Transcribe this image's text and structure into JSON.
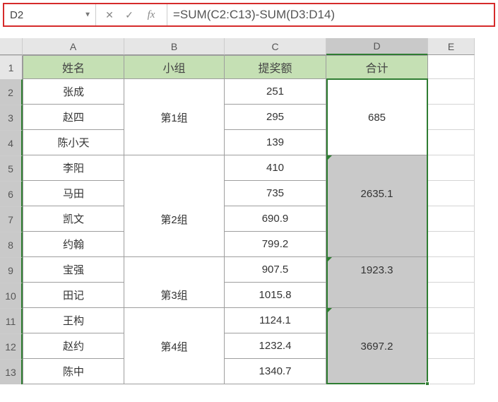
{
  "formula_bar": {
    "cell_ref": "D2",
    "cancel": "✕",
    "confirm": "✓",
    "fx": "fx",
    "formula": "=SUM(C2:C13)-SUM(D3:D14)"
  },
  "columns": {
    "A": "A",
    "B": "B",
    "C": "C",
    "D": "D",
    "E": "E"
  },
  "row_labels": [
    "1",
    "2",
    "3",
    "4",
    "5",
    "6",
    "7",
    "8",
    "9",
    "10",
    "11",
    "12",
    "13"
  ],
  "headers": {
    "name": "姓名",
    "group": "小组",
    "bonus": "提奖额",
    "total": "合计"
  },
  "names": [
    "张成",
    "赵四",
    "陈小天",
    "李阳",
    "马田",
    "凯文",
    "约翰",
    "宝强",
    "田记",
    "王构",
    "赵约",
    "陈中"
  ],
  "groups": {
    "g1": "第1组",
    "g2": "第2组",
    "g3": "第3组",
    "g4": "第4组"
  },
  "bonus": [
    "251",
    "295",
    "139",
    "410",
    "735",
    "690.9",
    "799.2",
    "907.5",
    "1015.8",
    "1124.1",
    "1232.4",
    "1340.7"
  ],
  "totals": {
    "d3": "685",
    "d6": "2635.1",
    "d9": "1923.3",
    "d12": "3697.2"
  },
  "chart_data": {
    "type": "table",
    "headers": [
      "姓名",
      "小组",
      "提奖额",
      "合计"
    ],
    "rows": [
      {
        "name": "张成",
        "group": "第1组",
        "bonus": 251,
        "total": null
      },
      {
        "name": "赵四",
        "group": "第1组",
        "bonus": 295,
        "total": 685
      },
      {
        "name": "陈小天",
        "group": "第1组",
        "bonus": 139,
        "total": null
      },
      {
        "name": "李阳",
        "group": "第2组",
        "bonus": 410,
        "total": null
      },
      {
        "name": "马田",
        "group": "第2组",
        "bonus": 735,
        "total": 2635.1
      },
      {
        "name": "凯文",
        "group": "第2组",
        "bonus": 690.9,
        "total": null
      },
      {
        "name": "约翰",
        "group": "第2组",
        "bonus": 799.2,
        "total": null
      },
      {
        "name": "宝强",
        "group": "第3组",
        "bonus": 907.5,
        "total": 1923.3
      },
      {
        "name": "田记",
        "group": "第3组",
        "bonus": 1015.8,
        "total": null
      },
      {
        "name": "王构",
        "group": "第4组",
        "bonus": 1124.1,
        "total": null
      },
      {
        "name": "赵约",
        "group": "第4组",
        "bonus": 1232.4,
        "total": 3697.2
      },
      {
        "name": "陈中",
        "group": "第4组",
        "bonus": 1340.7,
        "total": null
      }
    ]
  }
}
